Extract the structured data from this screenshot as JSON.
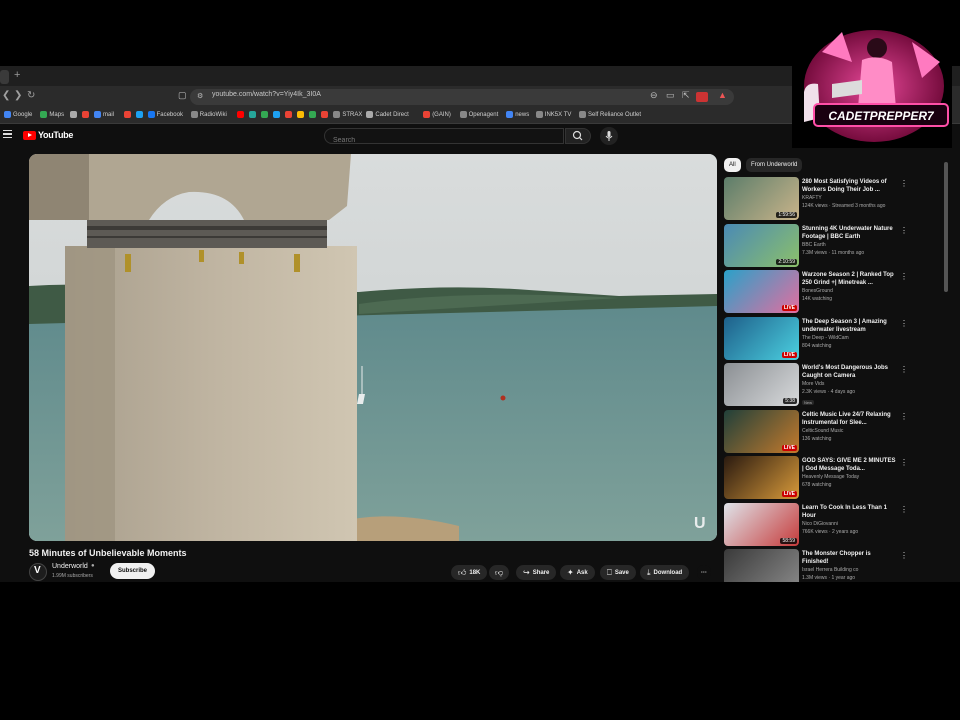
{
  "browser": {
    "url": "youtube.com/watch?v=Yiy4Ik_3I0A",
    "bookmarks": [
      {
        "label": "Google",
        "color": "#4285f4"
      },
      {
        "label": "Maps",
        "color": "#34a853"
      },
      {
        "label": "",
        "color": "#aaa"
      },
      {
        "label": "",
        "color": "#ea4335"
      },
      {
        "label": "mail",
        "color": "#4285f4"
      },
      {
        "label": "",
        "color": "#ea4335"
      },
      {
        "label": "",
        "color": "#1da1f2"
      },
      {
        "label": "Facebook",
        "color": "#1877f2"
      },
      {
        "label": "RadioWiki",
        "color": "#888"
      },
      {
        "label": "",
        "color": "#ff0000"
      },
      {
        "label": "",
        "color": "#26a69a"
      },
      {
        "label": "",
        "color": "#34a853"
      },
      {
        "label": "",
        "color": "#1da1f2"
      },
      {
        "label": "",
        "color": "#ea4335"
      },
      {
        "label": "",
        "color": "#fbbc05"
      },
      {
        "label": "",
        "color": "#34a853"
      },
      {
        "label": "",
        "color": "#ea4335"
      },
      {
        "label": "STRAX",
        "color": "#888"
      },
      {
        "label": "Cadet Direct",
        "color": "#aaa"
      },
      {
        "label": "(GAIN)",
        "color": "#ea4335"
      },
      {
        "label": "Openagent",
        "color": "#888"
      },
      {
        "label": "news",
        "color": "#4285f4"
      },
      {
        "label": "INK5X TV",
        "color": "#888"
      },
      {
        "label": "Self Reliance Outlet",
        "color": "#888"
      }
    ]
  },
  "youtube": {
    "logo_text": "YouTube",
    "search_placeholder": "Search",
    "video": {
      "title": "58 Minutes of Unbelievable Moments",
      "channel": "Underworld",
      "verified_mark": "●",
      "subscribers": "1.99M subscribers",
      "subscribe_label": "Subscribe",
      "likes": "18K",
      "share_label": "Share",
      "ask_label": "Ask",
      "save_label": "Save",
      "download_label": "Download",
      "more_label": "···",
      "watermark": "U"
    },
    "chips": [
      "All",
      "From Underworld"
    ],
    "recommendations": [
      {
        "title": "280 Most Satisfying Videos of Workers Doing Their Job ...",
        "channel": "KRAFTY",
        "meta": "124K views · Streamed 3 months ago",
        "badge": "1:59:56",
        "badge_type": "duration"
      },
      {
        "title": "Stunning 4K Underwater Nature Footage | BBC Earth",
        "channel": "BBC Earth",
        "meta": "7.3M views · 11 months ago",
        "badge": "2:10:59",
        "badge_type": "duration"
      },
      {
        "title": "Warzone Season 2 | Ranked Top 250 Grind +| Minetreak ...",
        "channel": "BonesGround",
        "meta": "14K watching",
        "badge": "LIVE",
        "badge_type": "live"
      },
      {
        "title": "The Deep Season 3 | Amazing underwater livestream",
        "channel": "The Deep - WildCam",
        "meta": "804 watching",
        "badge": "LIVE",
        "badge_type": "live"
      },
      {
        "title": "World's Most Dangerous Jobs Caught on Camera",
        "channel": "More Vids",
        "meta": "2.3K views · 4 days ago",
        "badge": "5:38",
        "badge_type": "duration",
        "new": "New"
      },
      {
        "title": "Celtic Music Live 24/7 Relaxing Instrumental for Slee...",
        "channel": "CelticSound Music",
        "meta": "136 watching",
        "badge": "LIVE",
        "badge_type": "live"
      },
      {
        "title": "GOD SAYS: GIVE ME 2 MINUTES | God Message Toda...",
        "channel": "Heavenly Message Today",
        "meta": "678 watching",
        "badge": "LIVE",
        "badge_type": "live"
      },
      {
        "title": "Learn To Cook In Less Than 1 Hour",
        "channel": "Nico DiGiovanni",
        "meta": "766K views · 2 years ago",
        "badge": "58:59",
        "badge_type": "duration"
      },
      {
        "title": "The Monster Chopper is Finished!",
        "channel": "Israel Herrera Building co",
        "meta": "1.3M views · 1 year ago",
        "badge": "",
        "badge_type": "none"
      }
    ]
  },
  "colors": {
    "yt_red": "#ff0000",
    "page_bg": "#0f0f0f",
    "pill_bg": "#272727"
  }
}
